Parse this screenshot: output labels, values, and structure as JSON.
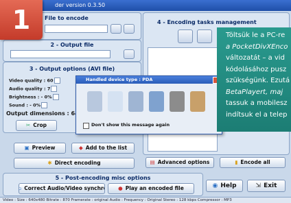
{
  "badge": "1",
  "window_title": "der version 0.3.50",
  "input": {
    "title": "File to encode"
  },
  "output": {
    "title": "2 - Output file"
  },
  "options": {
    "title": "3 - Output options (AVI file)",
    "video_quality_label": "Video quality : 60",
    "audio_quality_label": "Audio quality : 7",
    "brightness_label": "Brightness : - 0%",
    "sound_label": "Sound : - 0%",
    "dimensions_label": "Output dimensions : 640",
    "crop_label": "Crop"
  },
  "buttons": {
    "preview": "Preview",
    "add_list": "Add to the list",
    "direct_encoding": "Direct encoding",
    "advanced": "Advanced options",
    "encode_all": "Encode all",
    "correct_av": "Correct Audio/Video synchro",
    "play_encoded": "Play an encoded file",
    "help": "Help",
    "exit": "Exit"
  },
  "tasks": {
    "title": "4 - Encoding tasks management"
  },
  "post": {
    "title": "5 - Post-encoding misc options"
  },
  "dialog": {
    "title": "Handled device type : PDA",
    "checkbox_label": "Don't show this message again"
  },
  "callout": {
    "lines": [
      "Töltsük le a PC-re",
      "a PocketDivXEnco",
      "változatát – a vid",
      "kódolásához pusz",
      "szükségünk. Ezutá",
      "BetaPlayert, maj",
      "tassuk a mobilesz",
      "indítsuk el a telep"
    ]
  },
  "status_bar": "Video :          Size : 640x480          Bitrate : 870          Framerate : original          Audio :          Frequency : Original          Stereo :  128 kbps          Compressor : MP3"
}
